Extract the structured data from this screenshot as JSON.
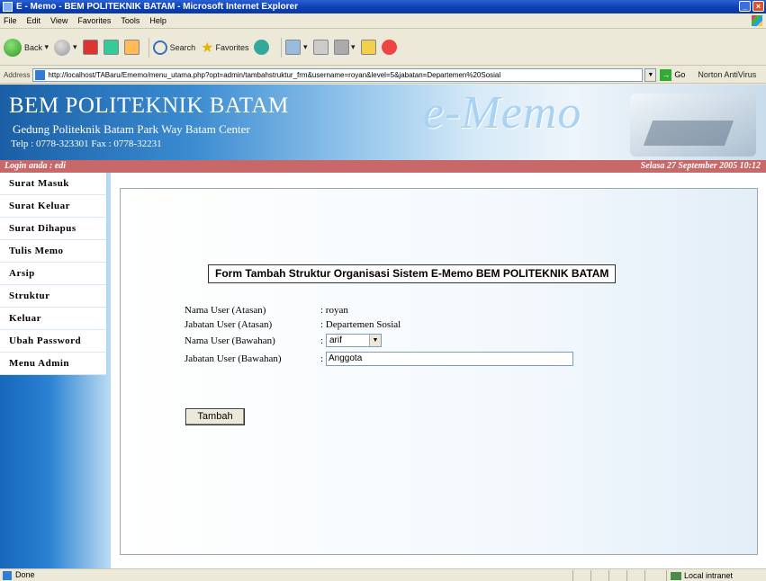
{
  "window": {
    "title": "E - Memo - BEM POLITEKNIK BATAM - Microsoft Internet Explorer"
  },
  "menubar": [
    "File",
    "Edit",
    "View",
    "Favorites",
    "Tools",
    "Help"
  ],
  "toolbar": {
    "back_label": "Back",
    "search_label": "Search",
    "favorites_label": "Favorites"
  },
  "address": {
    "label": "Address",
    "url": "http://localhost/TABaru/Ememo/menu_utama.php?opt=admin/tambahstruktur_frm&username=royan&level=5&jabatan=Departemen%20Sosial",
    "go_label": "Go",
    "norton_label": "Norton AntiVirus"
  },
  "banner": {
    "title": "BEM POLITEKNIK BATAM",
    "subtitle": "Gedung Politeknik Batam Park Way Batam Center",
    "telp": "Telp : 0778-323301 Fax : 0778-32231",
    "logo_text": "e-Memo"
  },
  "loginbar": {
    "user": "Login anda : edi",
    "datetime": "Selasa 27 September 2005 10:12"
  },
  "sidebar": {
    "items": [
      {
        "label": "Surat Masuk"
      },
      {
        "label": "Surat Keluar"
      },
      {
        "label": "Surat Dihapus"
      },
      {
        "label": "Tulis Memo"
      },
      {
        "label": "Arsip"
      },
      {
        "label": "Struktur"
      },
      {
        "label": "Keluar"
      },
      {
        "label": "Ubah Password"
      },
      {
        "label": "Menu Admin"
      }
    ]
  },
  "form": {
    "title": "Form Tambah Struktur Organisasi Sistem E-Memo BEM POLITEKNIK BATAM",
    "rows": [
      {
        "label": "Nama User (Atasan)",
        "value": ": royan"
      },
      {
        "label": "Jabatan User (Atasan)",
        "value": ": Departemen Sosial"
      },
      {
        "label": "Nama User (Bawahan)",
        "colon": ":",
        "select_value": "arif"
      },
      {
        "label": "Jabatan User (Bawahan)",
        "colon": ":",
        "input_value": "Anggota"
      }
    ],
    "submit_label": "Tambah"
  },
  "status": {
    "text": "Done",
    "zone": "Local intranet"
  },
  "colors": {
    "login_bar": "#c86868",
    "sidebar_blue": "#2b82d2",
    "title_bar": "#0a3fb0"
  }
}
